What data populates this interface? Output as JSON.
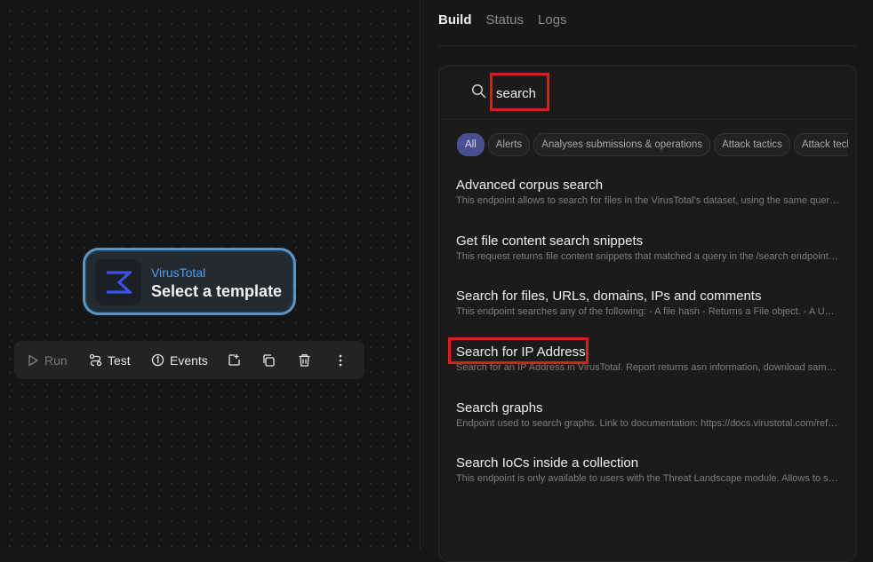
{
  "node": {
    "provider": "VirusTotal",
    "title": "Select a template"
  },
  "toolbar": {
    "run_label": "Run",
    "test_label": "Test",
    "events_label": "Events"
  },
  "tabs": [
    {
      "label": "Build",
      "active": true
    },
    {
      "label": "Status",
      "active": false
    },
    {
      "label": "Logs",
      "active": false
    }
  ],
  "search": {
    "value": "search",
    "placeholder": ""
  },
  "filters": [
    "All",
    "Alerts",
    "Analyses submissions & operations",
    "Attack tactics",
    "Attack techniques"
  ],
  "results": [
    {
      "title": "Advanced corpus search",
      "description": "This endpoint allows to search for files in the VirusTotal's dataset, using the same query syntax that you would use in VirusTotal Intelligence."
    },
    {
      "title": "Get file content search snippets",
      "description": "This request returns file content snippets that matched a query in the /search endpoint with content searches."
    },
    {
      "title": "Search for files, URLs, domains, IPs and comments",
      "description": "This endpoint searches any of the following: - A file hash - Returns a File object. - A URL - Returns a URL object."
    },
    {
      "title": "Search for IP Address",
      "description": "Search for an IP Address in VirusTotal. Report returns asn information, download samples and detected URLs."
    },
    {
      "title": "Search graphs",
      "description": "Endpoint used to search graphs. Link to documentation: https://docs.virustotal.com/reference/graphs"
    },
    {
      "title": "Search IoCs inside a collection",
      "description": "This endpoint is only available to users with the Threat Landscape module. Allows to search IoCs inside a collection."
    }
  ],
  "colors": {
    "accent": "#4a9ff0",
    "highlight": "#d61f1f",
    "chip_active": "#4a4f92"
  }
}
